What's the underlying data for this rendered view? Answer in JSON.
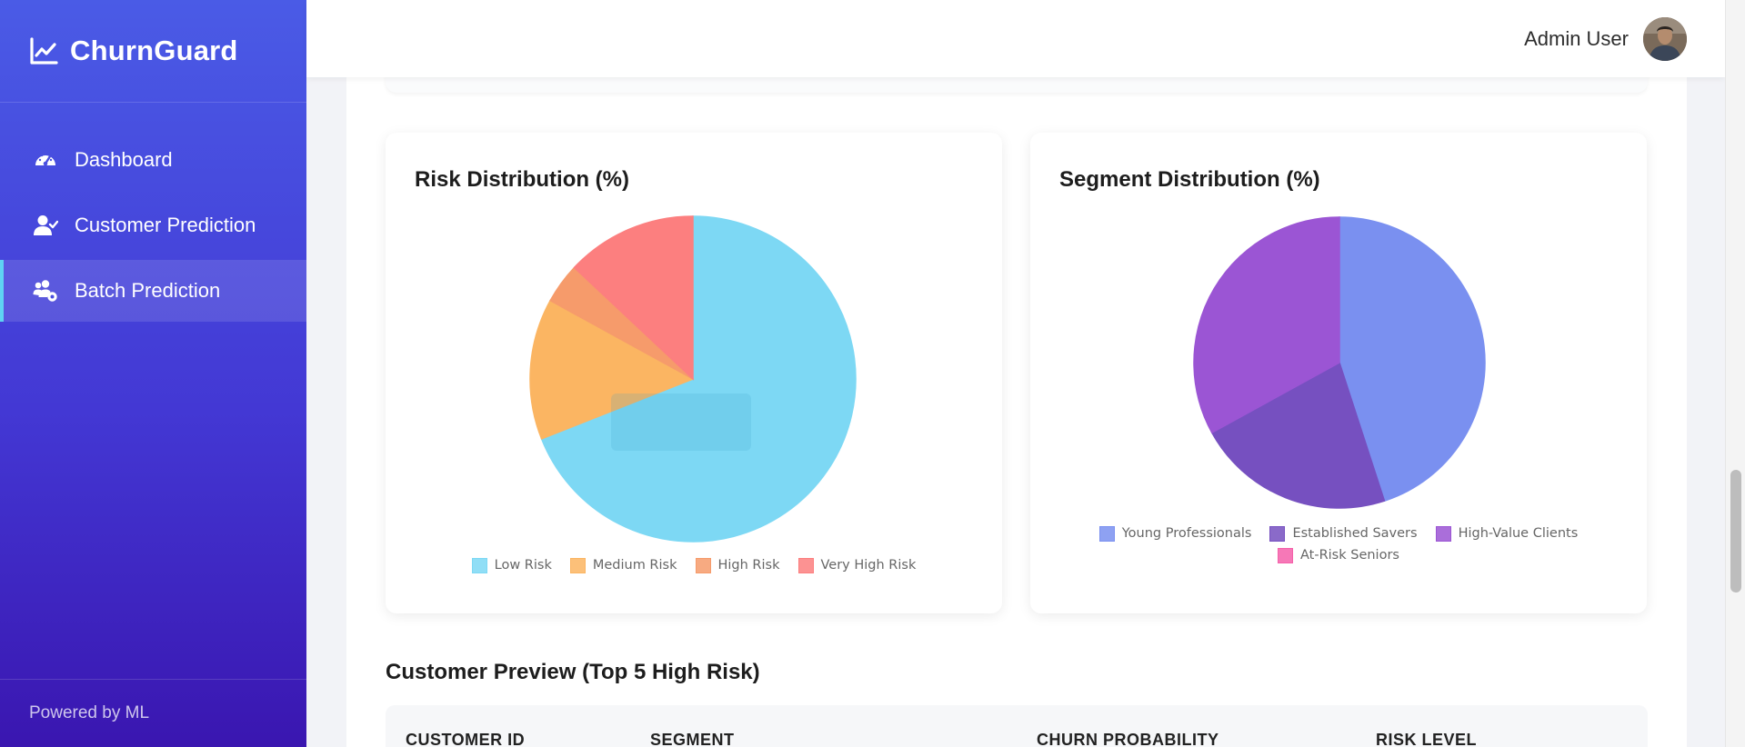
{
  "app": {
    "brand": "ChurnGuard"
  },
  "sidebar": {
    "items": [
      {
        "label": "Dashboard",
        "icon": "gauge-icon",
        "active": false
      },
      {
        "label": "Customer Prediction",
        "icon": "user-check-icon",
        "active": false
      },
      {
        "label": "Batch Prediction",
        "icon": "users-gear-icon",
        "active": true
      }
    ],
    "footer": "Powered by ML"
  },
  "topbar": {
    "user_name": "Admin User"
  },
  "charts": {
    "risk": {
      "title": "Risk Distribution (%)"
    },
    "segment": {
      "title": "Segment Distribution (%)"
    }
  },
  "chart_data": [
    {
      "type": "pie",
      "title": "Risk Distribution (%)",
      "labels": [
        "Low Risk",
        "Medium Risk",
        "High Risk",
        "Very High Risk"
      ],
      "values": [
        69,
        14,
        4,
        13
      ],
      "colors": [
        "#7dd8f4",
        "#fbb562",
        "#f69b6b",
        "#fc7f7f"
      ],
      "legend": "bottom"
    },
    {
      "type": "pie",
      "title": "Segment Distribution (%)",
      "labels": [
        "Young Professionals",
        "Established Savers",
        "High-Value Clients",
        "At-Risk Seniors"
      ],
      "values": [
        45,
        22,
        33,
        0
      ],
      "colors": [
        "#7a90f0",
        "#7650c0",
        "#9b55d4",
        "#f560aa"
      ],
      "legend": "bottom"
    }
  ],
  "preview": {
    "title": "Customer Preview (Top 5 High Risk)",
    "columns": [
      "CUSTOMER ID",
      "SEGMENT",
      "CHURN PROBABILITY",
      "RISK LEVEL"
    ]
  }
}
